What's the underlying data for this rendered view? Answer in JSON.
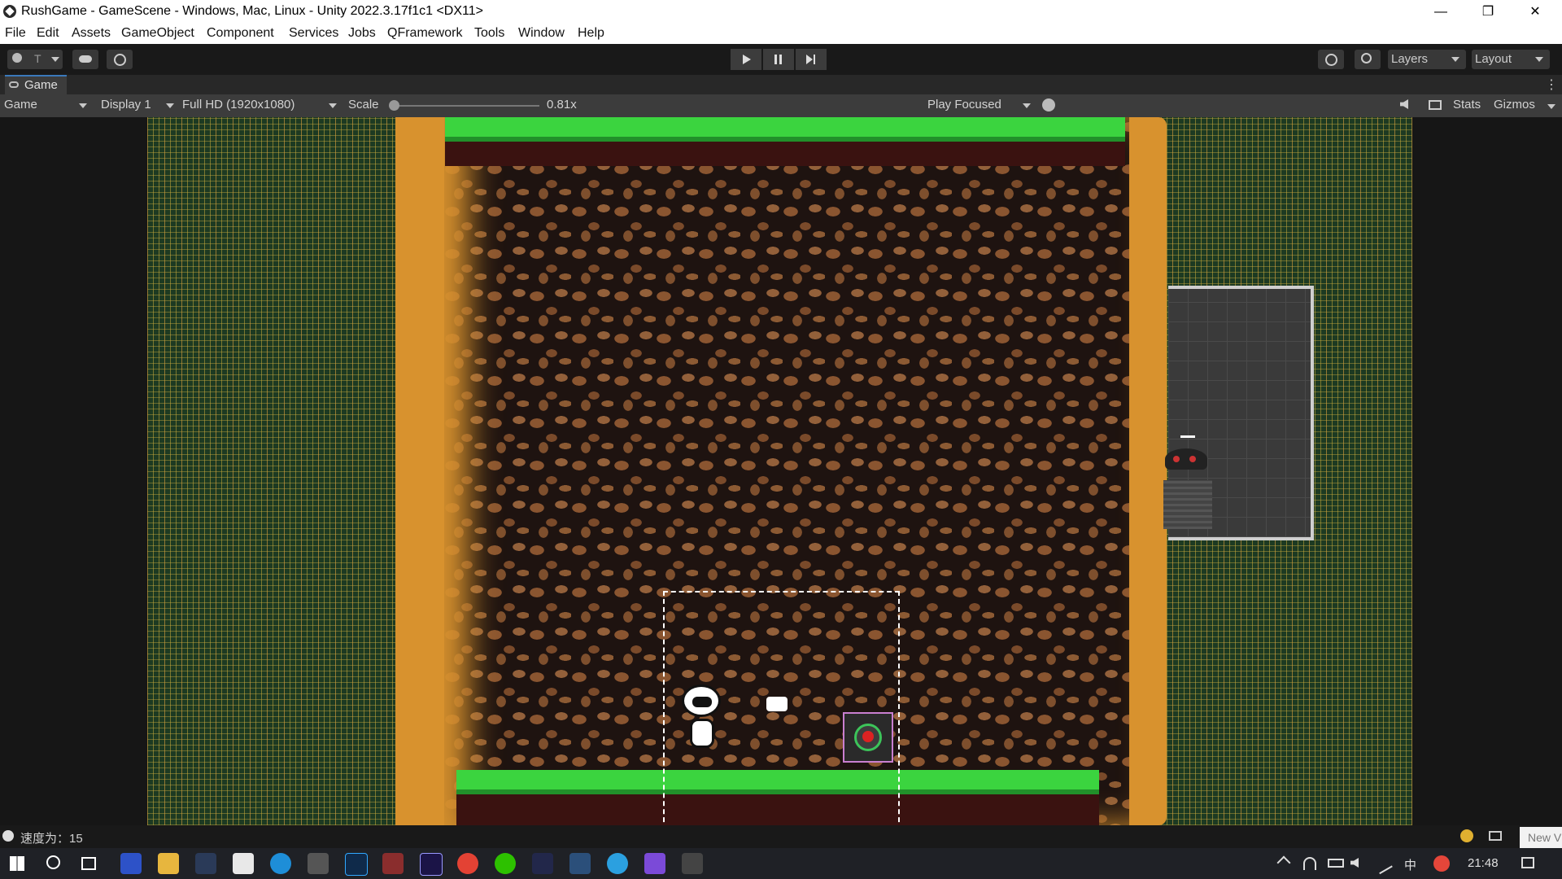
{
  "window": {
    "title": "RushGame - GameScene - Windows, Mac, Linux - Unity 2022.3.17f1c1 <DX11>",
    "minimize_glyph": "—",
    "maximize_glyph": "❐",
    "close_glyph": "✕"
  },
  "menu": {
    "items": [
      "File",
      "Edit",
      "Assets",
      "GameObject",
      "Component",
      "Services",
      "Jobs",
      "QFramework",
      "Tools",
      "Window",
      "Help"
    ]
  },
  "toolbar": {
    "account_glyph": "T",
    "layers_label": "Layers",
    "layout_label": "Layout"
  },
  "panel": {
    "tab_label": "Game"
  },
  "game_toolbar": {
    "mode": "Game",
    "display": "Display 1",
    "resolution": "Full HD (1920x1080)",
    "scale_label": "Scale",
    "scale_value": "0.81x",
    "play_mode": "Play Focused",
    "stats_label": "Stats",
    "gizmos_label": "Gizmos"
  },
  "status": {
    "message": "速度为：15",
    "corner_tooltip": "New V"
  },
  "taskbar": {
    "ime": "中",
    "time": "21:48"
  },
  "colors": {
    "sand": "#d8922e",
    "grass": "#3bd43f",
    "editor_bg": "#191919"
  }
}
